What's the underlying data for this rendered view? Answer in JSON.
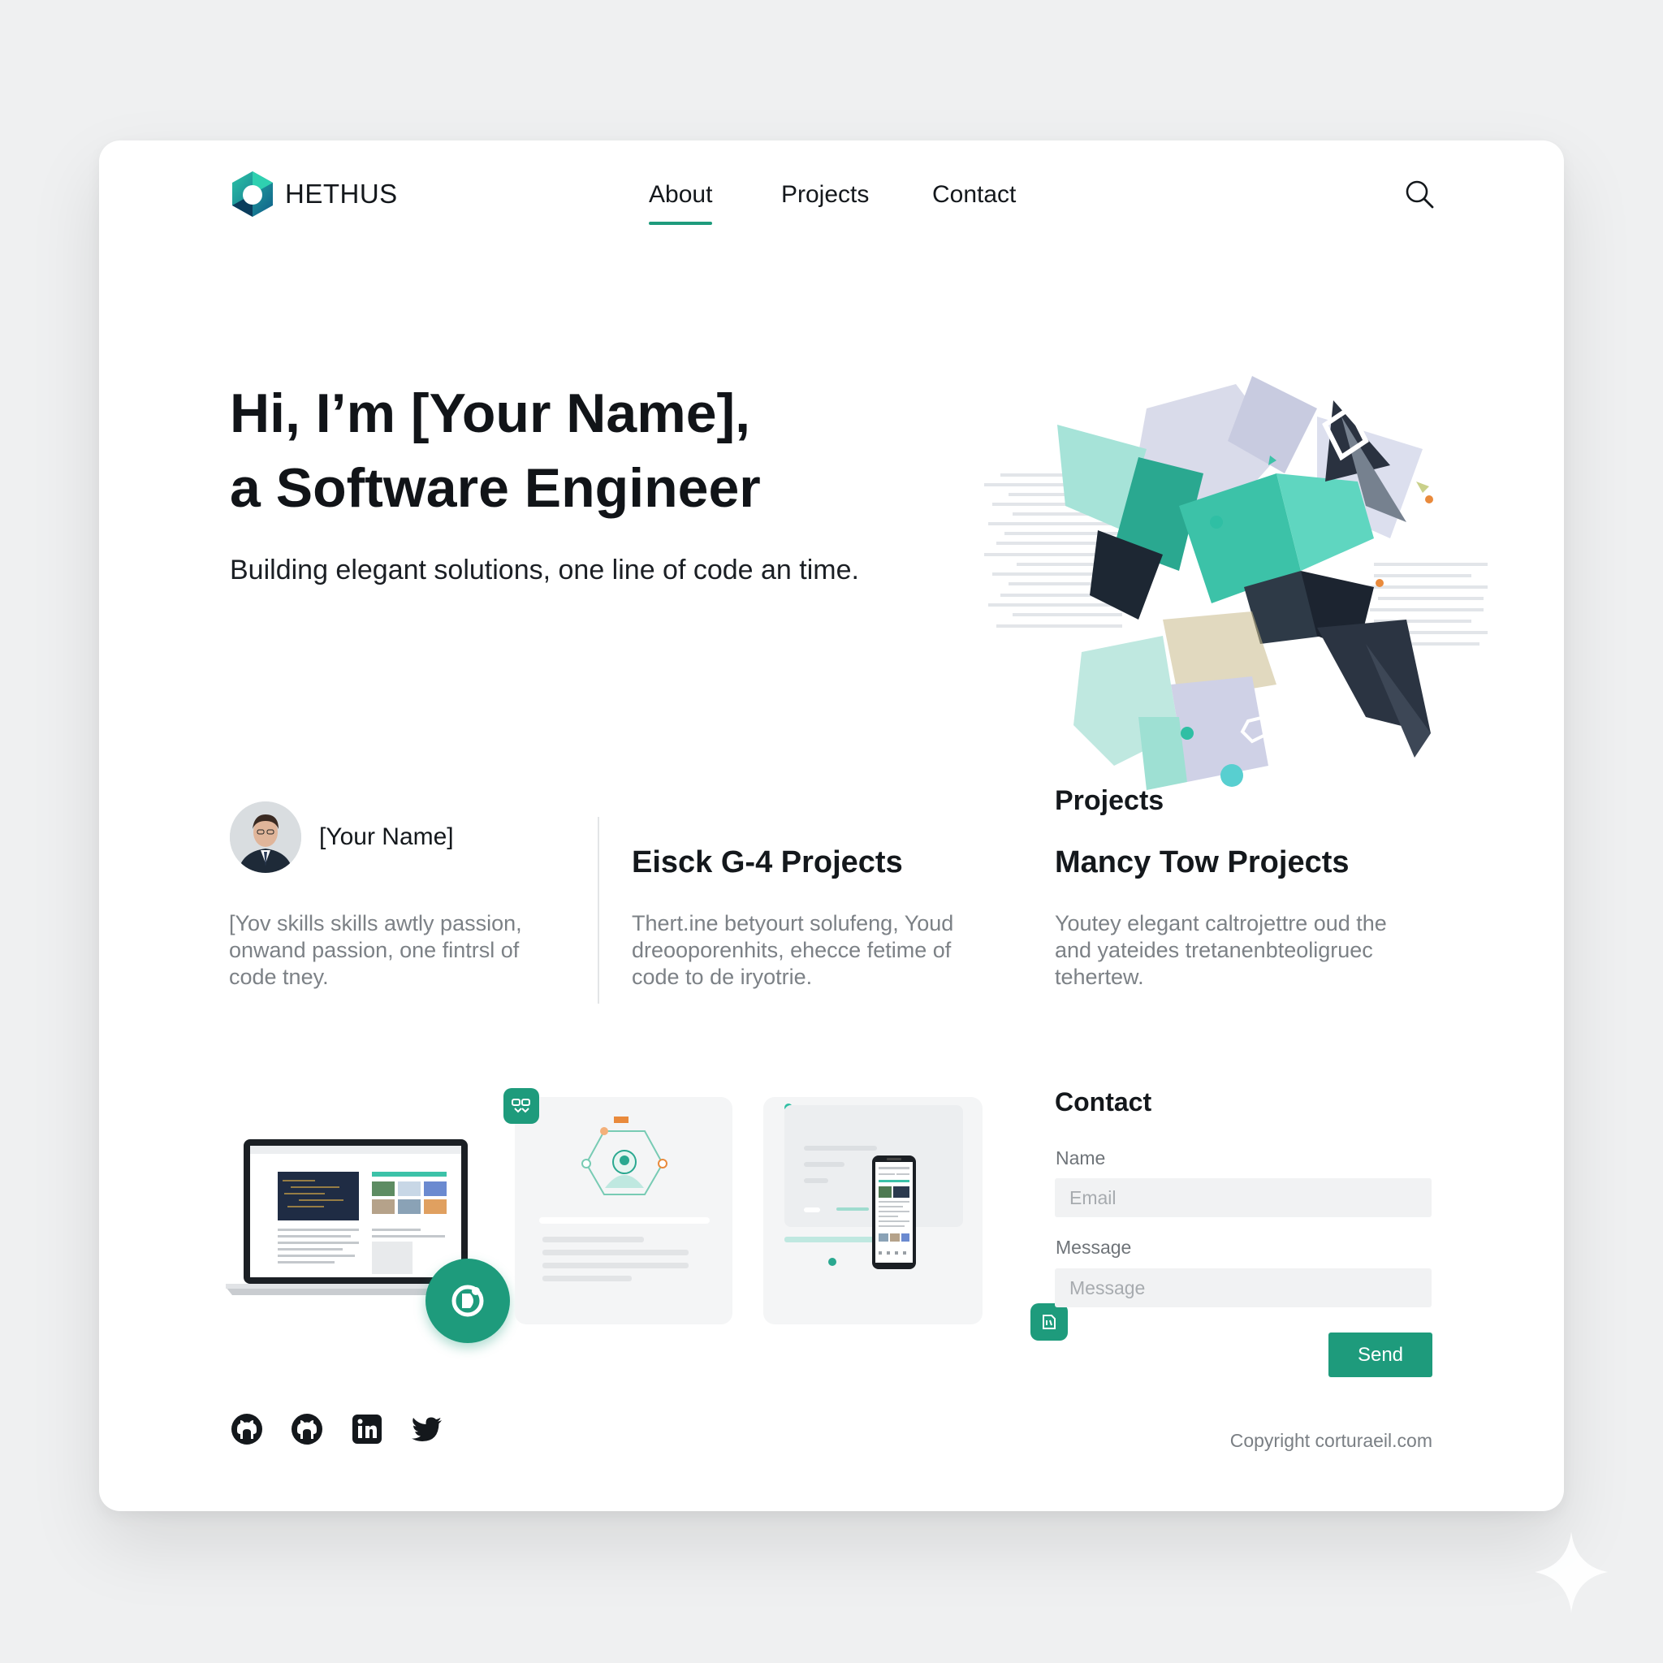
{
  "brand": {
    "name": "HETHUS",
    "accent": "#1e9b7c",
    "dark": "#14181c"
  },
  "nav": {
    "items": [
      {
        "label": "About",
        "active": true
      },
      {
        "label": "Projects",
        "active": false
      },
      {
        "label": "Contact",
        "active": false
      }
    ],
    "search_icon": "search-icon"
  },
  "hero": {
    "title_line1": "Hi, I’m [Your Name],",
    "title_line2": "a Software Engineer",
    "subtitle": "Building elegant solutions, one line of code an time."
  },
  "profile": {
    "name": "[Your Name]",
    "description": "[Yov skills skills awtly passion, onwand passion, one fintrsl of code tney."
  },
  "columns": [
    {
      "title": "Eisck G-4 Projects",
      "description": "Thert.ine betyourt solufeng, Youd dreooporenhits, ehecce fetime of code to de iryotrie."
    },
    {
      "label": "Projects",
      "title": "Mancy Tow Projects",
      "description": "Youtey elegant caltrojettre oud the and yateides tretanenbteoligruec tehertew."
    }
  ],
  "showcase": {
    "icons": [
      "laptop-screenshot",
      "network-node-icon",
      "phone-screenshot",
      "code-badge-icon",
      "refresh-badge-icon",
      "file-badge-icon"
    ]
  },
  "contact": {
    "title": "Contact",
    "name_label": "Name",
    "email_placeholder": "Email",
    "message_label": "Message",
    "message_placeholder": "Message",
    "send_label": "Send"
  },
  "footer": {
    "social": [
      "github-icon",
      "github-icon",
      "linkedin-icon",
      "twitter-icon"
    ],
    "copyright": "Copyright corturaeil.com"
  }
}
